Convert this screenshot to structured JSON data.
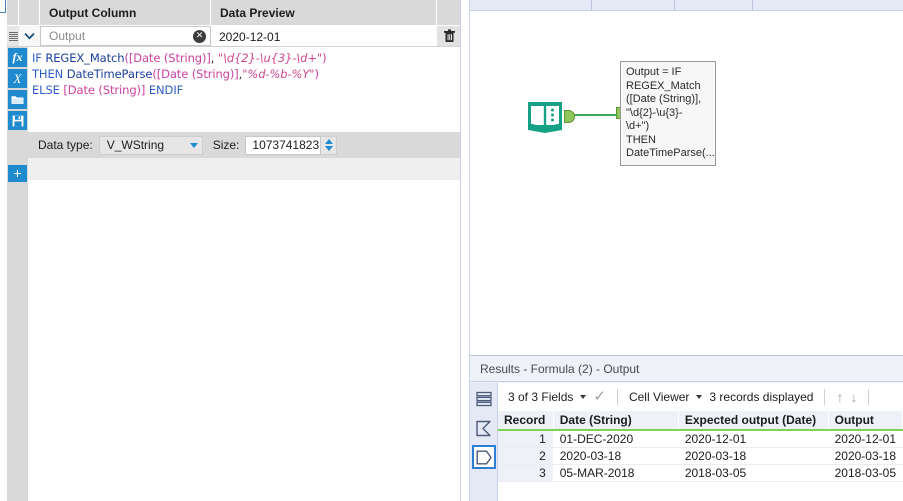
{
  "config_panel": {
    "headers": {
      "output_column": "Output Column",
      "data_preview": "Data Preview"
    },
    "output_field": {
      "value": "Output",
      "placeholder": "Output",
      "clear_icon": "clear-circle-icon"
    },
    "data_preview_value": "2020-12-01",
    "delete_icon": "trash-icon",
    "expand_icon": "chevron-down-icon",
    "drag_handle_icon": "drag-handle-icon",
    "rail": {
      "function_icon": "fx",
      "variable_icon": "X",
      "open_icon": "folder-icon",
      "save_icon": "save-disk-icon",
      "add_icon": "+"
    },
    "formula": {
      "line1": {
        "kw": "IF",
        "fn": "REGEX_Match",
        "open": "(",
        "field": "[Date (String)]",
        "comma": ", ",
        "str": "\"\\d{2}-\\u{3}-\\d+\"",
        "close": ")"
      },
      "line2": {
        "kw": "THEN",
        "fn": "DateTimeParse",
        "open": "(",
        "field": "[Date (String)]",
        "comma": ",",
        "str": "\"%d-%b-%Y\"",
        "close": ")"
      },
      "line3": {
        "kw": "ELSE",
        "field": "[Date (String)]",
        "kw2": "ENDIF"
      }
    },
    "data_type": {
      "label": "Data type:",
      "value": "V_WString",
      "size_label": "Size:",
      "size_value": "1073741823"
    }
  },
  "canvas": {
    "input_node": {
      "icon": "text-input-book-icon",
      "color": "#16a085"
    },
    "formula_node": {
      "icon": "formula-flask-icon",
      "color": "#1b5ea8",
      "selected": true
    },
    "connector_color": "#3aa65a",
    "tooltip": "Output = IF\nREGEX_Match\n([Date (String)],\n\"\\d{2}-\\u{3}-\n\\d+\")\nTHEN\nDateTimeParse(..."
  },
  "results": {
    "title": "Results - Formula (2) - Output",
    "toolbar": {
      "fields_label": "3 of 3 Fields",
      "fields_caret": "chevron-down-icon",
      "check_icon": "check-icon",
      "viewer_label": "Cell Viewer",
      "viewer_caret": "chevron-down-icon",
      "records_label": "3 records displayed",
      "up_icon": "arrow-up-icon",
      "down_icon": "arrow-down-icon"
    },
    "rail": {
      "messages_icon": "list-stack-icon",
      "summary_icon": "sigma-icon",
      "data_icon": "data-shape-icon"
    },
    "table": {
      "columns": [
        "Record",
        "Date (String)",
        "Expected output (Date)",
        "Output"
      ],
      "rows": [
        [
          "1",
          "01-DEC-2020",
          "2020-12-01",
          "2020-12-01"
        ],
        [
          "2",
          "2020-03-18",
          "2020-03-18",
          "2020-03-18"
        ],
        [
          "3",
          "05-MAR-2018",
          "2018-03-05",
          "2018-03-05"
        ]
      ]
    }
  }
}
